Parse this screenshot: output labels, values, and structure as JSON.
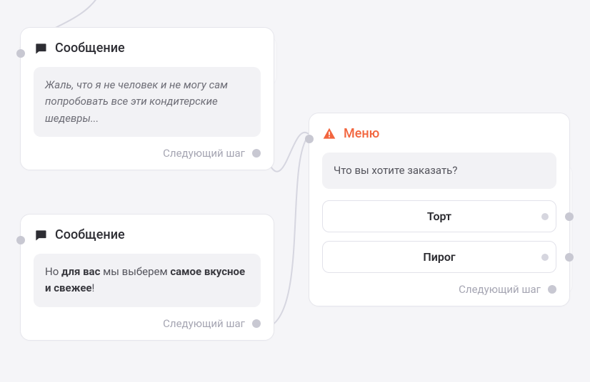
{
  "cards": {
    "msg1": {
      "title": "Сообщение",
      "body_italic": "Жаль, что я не человек и не могу сам попробовать все эти кондитерские шедевры...",
      "next": "Следующий шаг"
    },
    "msg2": {
      "title": "Сообщение",
      "body_pre": "Но ",
      "body_b1": "для вас",
      "body_mid": " мы выберем ",
      "body_b2": "самое вкусное и свежее",
      "body_post": "!",
      "next": "Следующий шаг"
    },
    "menu": {
      "title": "Меню",
      "prompt": "Что вы хотите заказать?",
      "option1": "Торт",
      "option2": "Пирог",
      "next": "Следующий шаг"
    }
  }
}
